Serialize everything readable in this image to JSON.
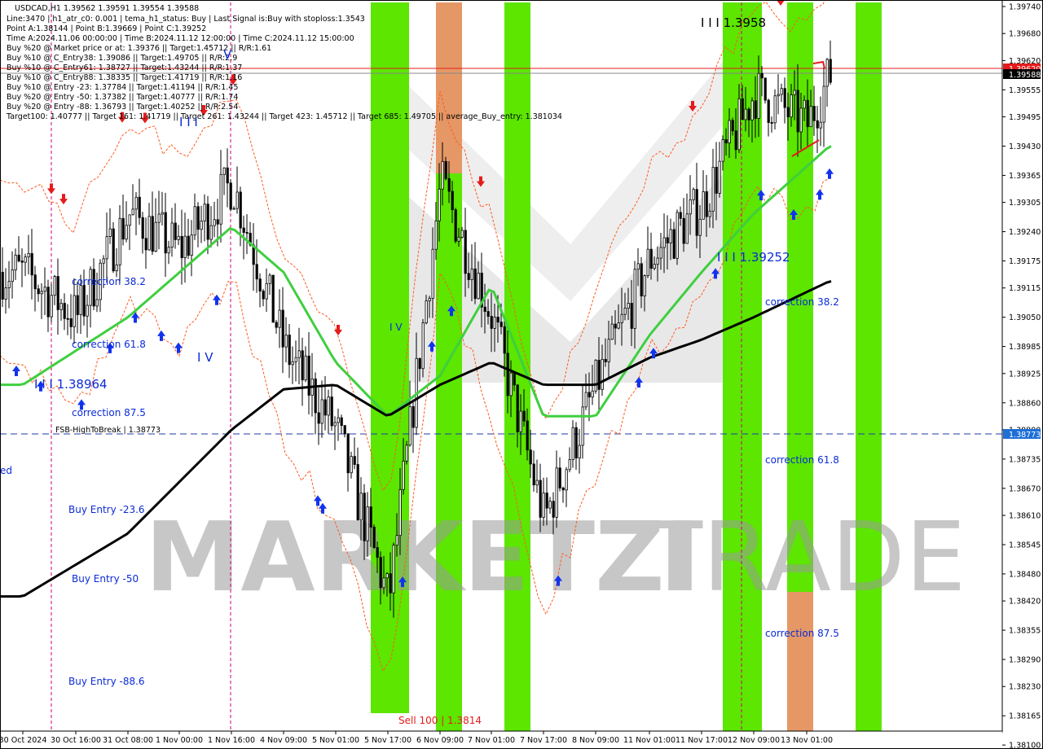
{
  "symbol_line": "USDCAD,H1  1.39562 1.39591 1.39554 1.39588",
  "info_lines": [
    "Line:3470  |  h1_atr_c0: 0.001  |  tema_h1_status: Buy  |  Last Signal is:Buy with stoploss:1.3543",
    "Point A:1.38144  |  Point B:1.39669  |  Point C:1.39252",
    "Time A:2024.11.06 00:00:00  |  Time B:2024.11.12 12:00:00  |  Time C:2024.11.12 15:00:00",
    "Buy %20 @ Market price or at: 1.39376  ||  Target:1.45712  ||  R/R:1.61",
    "Buy %10 @ C_Entry38: 1.39086  ||  Target:1.49705  ||  R/R:2.9",
    "Buy %10 @ C_Entry61: 1.38727  ||  Target:1.43244  ||  R/R:1.37",
    "Buy %10 @ C_Entry88: 1.38335  ||  Target:1.41719  ||  R/R:1.16",
    "Buy %10 @ Entry -23: 1.37784  ||  Target:1.41194  ||  R/R:1.45",
    "Buy %20 @ Entry -50: 1.37382  ||  Target:1.40777  ||  R/R:1.74",
    "Buy %20 @ Entry -88: 1.36793  ||  Target:1.40252  ||  R/R:2.54",
    "Target100: 1.40777  ||  Target 161: 1.41719  ||  Target 261: 1.43244  ||  Target 423: 1.45712  ||  Target 685: 1.49705  ||  average_Buy_entry: 1.381034"
  ],
  "annotations": {
    "wave_left": "I I I 1.38964",
    "wave_top": "I I I 1.3958",
    "wave_right": "I I I 1.39252",
    "wave_iv": "I V",
    "wave_iv_mid": "I V",
    "wave_v_top": "V",
    "wave_iii_small": "I I I",
    "corr_382_left": "correction 38.2",
    "corr_618_left": "correction 61.8",
    "corr_875_left": "correction 87.5",
    "corr_382_right": "correction 38.2",
    "corr_618_right": "correction 61.8",
    "corr_875_right": "correction 87.5",
    "buy_entry_236": "Buy Entry -23.6",
    "buy_entry_50": "Buy Entry -50",
    "buy_entry_886": "Buy Entry -88.6",
    "fsb_label": "FSB-HighToBreak  |  1.38773",
    "sell_label": "Sell 100  |  1.3814",
    "edge_text": "ed"
  },
  "watermark": {
    "part1": "MARKETZI",
    "part2": "TRADE"
  },
  "price_tags": {
    "current": "1.39588",
    "red_line": "1.39620",
    "fsb": "1.38773"
  },
  "colors": {
    "bull_candle": "#000000",
    "bear_candle": "#000000",
    "green_zone": "#5ce600",
    "orange_zone": "#e59866",
    "ma_green": "#3fcf3f",
    "ma_black": "#000000",
    "channel": "#ff5a1f",
    "signal_up": "#1133ee",
    "signal_down": "#e51b1b",
    "fsb_line": "#1e3aa8",
    "current_tag_bg": "#000000",
    "red_tag_bg": "#e51b1b",
    "fsb_tag_bg": "#1e6fd6"
  },
  "chart_data": {
    "type": "candlestick",
    "symbol": "USDCAD",
    "timeframe": "H1",
    "ylim": [
      1.3814,
      1.3974
    ],
    "y_ticks": [
      "1.39740",
      "1.39680",
      "1.39620",
      "1.39555",
      "1.39495",
      "1.39430",
      "1.39365",
      "1.39305",
      "1.39240",
      "1.39175",
      "1.39115",
      "1.39050",
      "1.38985",
      "1.38925",
      "1.38860",
      "1.38800",
      "1.38735",
      "1.38670",
      "1.38610",
      "1.38545",
      "1.38480",
      "1.38420",
      "1.38355",
      "1.38290",
      "1.38230",
      "1.38165",
      "1.38100"
    ],
    "x_ticks": [
      "30 Oct 2024",
      "30 Oct 16:00",
      "31 Oct 08:00",
      "1 Nov 00:00",
      "1 Nov 16:00",
      "4 Nov 09:00",
      "5 Nov 01:00",
      "5 Nov 17:00",
      "6 Nov 09:00",
      "7 Nov 01:00",
      "7 Nov 17:00",
      "8 Nov 09:00",
      "11 Nov 01:00",
      "11 Nov 17:00",
      "12 Nov 09:00",
      "13 Nov 01:00"
    ],
    "levels": {
      "fsb_high_to_break": 1.38773,
      "current": 1.39588,
      "red_line": 1.3962
    },
    "points": {
      "A": 1.38144,
      "B": 1.39669,
      "C": 1.39252
    },
    "close_path": [
      {
        "x": "30 Oct 2024",
        "y": 1.3915
      },
      {
        "x": "30 Oct 16:00",
        "y": 1.3905
      },
      {
        "x": "31 Oct 08:00",
        "y": 1.3928
      },
      {
        "x": "1 Nov 00:00",
        "y": 1.392
      },
      {
        "x": "1 Nov 16:00",
        "y": 1.3935
      },
      {
        "x": "4 Nov 09:00",
        "y": 1.3898
      },
      {
        "x": "5 Nov 01:00",
        "y": 1.388
      },
      {
        "x": "5 Nov 17:00",
        "y": 1.3842
      },
      {
        "x": "6 Nov 09:00",
        "y": 1.3935
      },
      {
        "x": "7 Nov 01:00",
        "y": 1.3905
      },
      {
        "x": "7 Nov 17:00",
        "y": 1.386
      },
      {
        "x": "8 Nov 09:00",
        "y": 1.389
      },
      {
        "x": "11 Nov 01:00",
        "y": 1.3918
      },
      {
        "x": "11 Nov 17:00",
        "y": 1.393
      },
      {
        "x": "12 Nov 09:00",
        "y": 1.3955
      },
      {
        "x": "13 Nov 01:00",
        "y": 1.3948
      },
      {
        "x": "13 Nov 09:00",
        "y": 1.39588
      }
    ],
    "green_ma_path": [
      {
        "x": "30 Oct 2024",
        "y": 1.389
      },
      {
        "x": "31 Oct 08:00",
        "y": 1.3905
      },
      {
        "x": "1 Nov 16:00",
        "y": 1.3925
      },
      {
        "x": "4 Nov 09:00",
        "y": 1.3915
      },
      {
        "x": "5 Nov 01:00",
        "y": 1.3895
      },
      {
        "x": "5 Nov 17:00",
        "y": 1.3883
      },
      {
        "x": "6 Nov 09:00",
        "y": 1.3892
      },
      {
        "x": "7 Nov 01:00",
        "y": 1.3912
      },
      {
        "x": "7 Nov 17:00",
        "y": 1.3883
      },
      {
        "x": "8 Nov 09:00",
        "y": 1.3883
      },
      {
        "x": "11 Nov 01:00",
        "y": 1.3901
      },
      {
        "x": "11 Nov 17:00",
        "y": 1.3915
      },
      {
        "x": "12 Nov 09:00",
        "y": 1.3928
      },
      {
        "x": "13 Nov 09:00",
        "y": 1.3943
      }
    ],
    "black_ma_path": [
      {
        "x": "30 Oct 2024",
        "y": 1.3843
      },
      {
        "x": "31 Oct 08:00",
        "y": 1.3857
      },
      {
        "x": "1 Nov 16:00",
        "y": 1.388
      },
      {
        "x": "4 Nov 09:00",
        "y": 1.3889
      },
      {
        "x": "5 Nov 01:00",
        "y": 1.389
      },
      {
        "x": "5 Nov 17:00",
        "y": 1.3883
      },
      {
        "x": "6 Nov 09:00",
        "y": 1.389
      },
      {
        "x": "7 Nov 01:00",
        "y": 1.3895
      },
      {
        "x": "7 Nov 17:00",
        "y": 1.389
      },
      {
        "x": "8 Nov 09:00",
        "y": 1.389
      },
      {
        "x": "11 Nov 01:00",
        "y": 1.3896
      },
      {
        "x": "11 Nov 17:00",
        "y": 1.39
      },
      {
        "x": "12 Nov 09:00",
        "y": 1.3905
      },
      {
        "x": "13 Nov 09:00",
        "y": 1.3913
      }
    ]
  }
}
